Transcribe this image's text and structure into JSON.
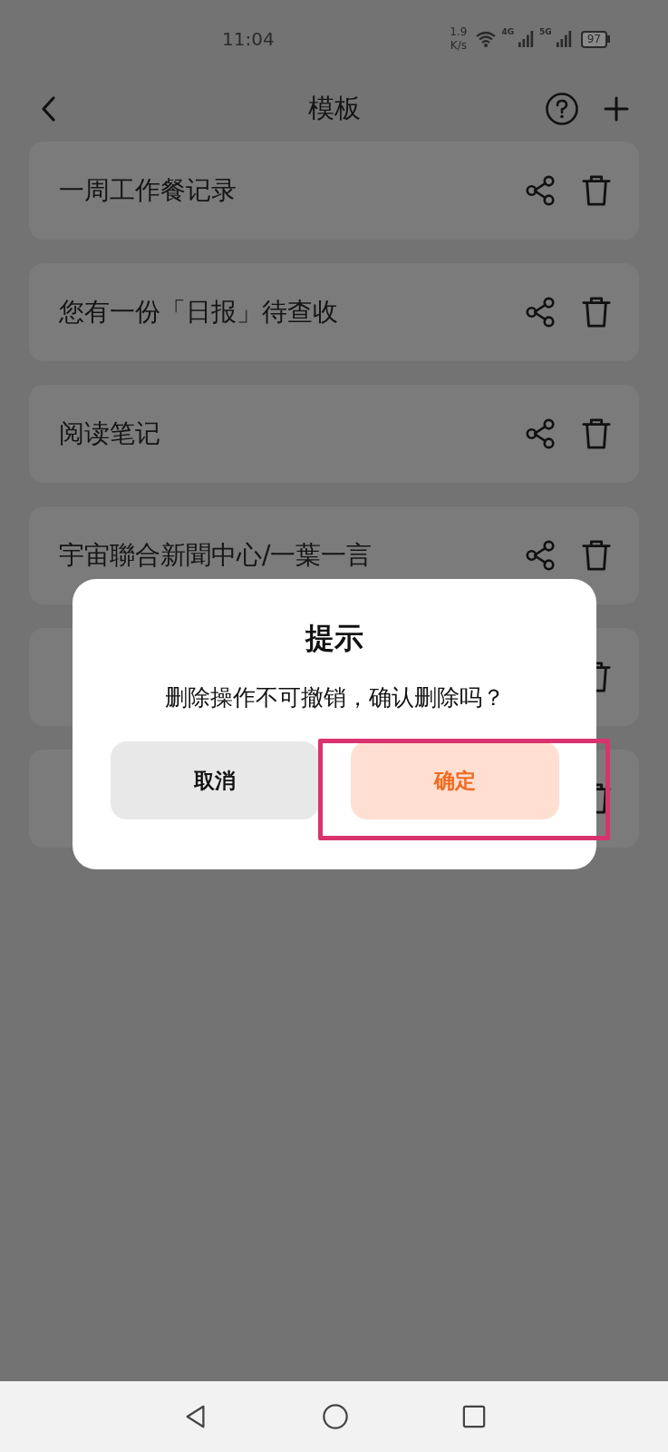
{
  "status_bar": {
    "time": "11:04",
    "speed_value": "1.9",
    "speed_unit": "K/s",
    "network_1": "4G",
    "network_2": "5G",
    "battery": "97"
  },
  "header": {
    "title": "模板"
  },
  "templates": [
    {
      "kind": "full",
      "title": "一周工作餐记录"
    },
    {
      "kind": "full",
      "title": "您有一份「日报」待查收"
    },
    {
      "kind": "full",
      "title": "阅读笔记"
    },
    {
      "kind": "full",
      "title": "宇宙聯合新聞中心/一葉一言"
    },
    {
      "kind": "covered"
    },
    {
      "kind": "covered"
    }
  ],
  "dialog": {
    "title": "提示",
    "message": "删除操作不可撤销，确认删除吗？",
    "buttons": [
      {
        "label": "取消",
        "kind": "cancel",
        "highlighted": false
      },
      {
        "label": "确定",
        "kind": "confirm",
        "highlighted": true
      }
    ]
  }
}
